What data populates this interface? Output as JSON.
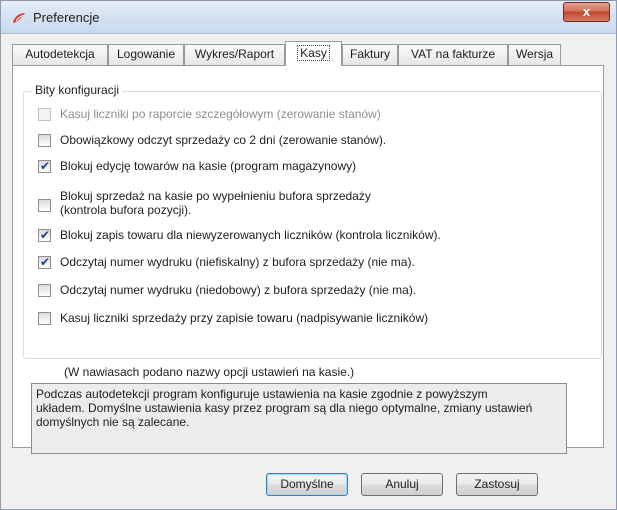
{
  "window": {
    "title": "Preferencje",
    "close_label": "x"
  },
  "tabs": [
    {
      "label": "Autodetekcja"
    },
    {
      "label": "Logowanie"
    },
    {
      "label": "Wykres/Raport"
    },
    {
      "label": "Kasy"
    },
    {
      "label": "Faktury"
    },
    {
      "label": "VAT na fakturze"
    },
    {
      "label": "Wersja"
    }
  ],
  "active_tab": "Kasy",
  "group": {
    "title": "Bity konfiguracji",
    "options": [
      {
        "label": "Kasuj liczniki po raporcie szczegółowym (zerowanie stanów)",
        "checked": false,
        "enabled": false
      },
      {
        "label": "Obowiązkowy odczyt sprzedaży co 2 dni (zerowanie stanów).",
        "checked": false,
        "enabled": true
      },
      {
        "label": "Blokuj edycję towarów na kasie (program magazynowy)",
        "checked": true,
        "enabled": true
      },
      {
        "label": "Blokuj sprzedaż na kasie po wypełnieniu bufora sprzedaży",
        "label2": "(kontrola bufora pozycji).",
        "checked": false,
        "enabled": true
      },
      {
        "label": "Blokuj zapis towaru dla niewyzerowanych liczników (kontrola liczników).",
        "checked": true,
        "enabled": true
      },
      {
        "label": "Odczytaj numer wydruku (niefiskalny) z bufora sprzedaży (nie ma).",
        "checked": true,
        "enabled": true
      },
      {
        "label": "Odczytaj numer wydruku (niedobowy) z bufora sprzedaży (nie ma).",
        "checked": false,
        "enabled": true
      },
      {
        "label": "Kasuj liczniki sprzedaży  przy zapisie towaru (nadpisywanie liczników)",
        "checked": false,
        "enabled": true
      }
    ]
  },
  "note": "(W nawiasach podano nazwy opcji ustawień na kasie.)",
  "description": {
    "line1": "Podczas autodetekcji program konfiguruje ustawienia na kasie zgodnie z powyższym",
    "line2": "układem. Domyślne ustawienia kasy przez program są dla niego optymalne, zmiany ustawień",
    "line3": "domyślnych nie są zalecane."
  },
  "buttons": {
    "defaults": "Domyślne",
    "cancel": "Anuluj",
    "apply": "Zastosuj"
  },
  "colors": {
    "titlebar": "#d4e1f1",
    "close_button": "#c2472e",
    "check_mark": "#1b3e8a"
  }
}
